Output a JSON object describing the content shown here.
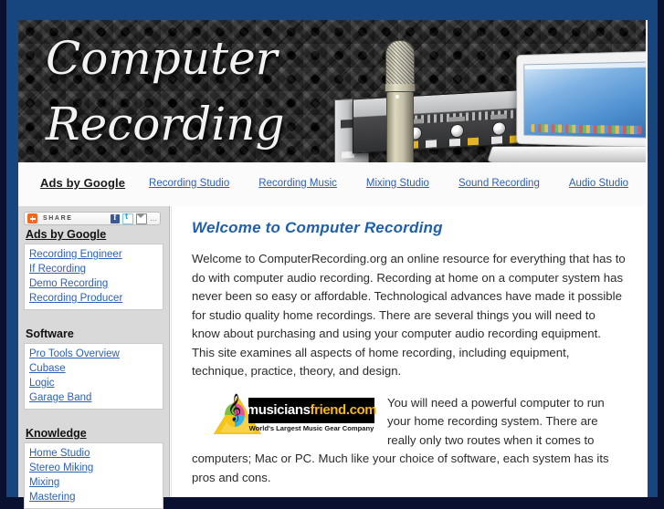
{
  "banner": {
    "title_line1": "Computer",
    "title_line2": "Recording",
    "title": "Computer\nRecording",
    "artwork": [
      "acoustic-foam-background",
      "condenser-microphone",
      "rack-preamp",
      "macbook-laptop"
    ]
  },
  "ad_nav": {
    "lead_label": "Ads by Google",
    "links": [
      "Recording Studio",
      "Recording Music",
      "Mixing Studio",
      "Sound Recording",
      "Audio Studio"
    ]
  },
  "sidebar": {
    "share": {
      "label": "SHARE",
      "plus_icon": "addthis-plus-icon",
      "icons": [
        "facebook-icon",
        "twitter-icon",
        "email-icon",
        "more-icon"
      ],
      "more_label": "…"
    },
    "sections": [
      {
        "heading": "Ads by Google",
        "underlined": true,
        "items": [
          "Recording Engineer",
          "If Recording",
          "Demo Recording",
          "Recording Producer"
        ]
      },
      {
        "heading": "Software",
        "underlined": false,
        "items": [
          "Pro Tools Overview",
          "Cubase",
          "Logic",
          "Garage Band"
        ]
      },
      {
        "heading": "Knowledge",
        "underlined": true,
        "items": [
          "Home Studio",
          "Stereo Miking",
          "Mixing",
          "Mastering"
        ]
      }
    ]
  },
  "main": {
    "heading": "Welcome to Computer Recording",
    "paragraph1": "Welcome to ComputerRecording.org an online resource for everything that has to do with computer audio recording. Recording at home on a computer system has never been so easy or affordable. Technological advances have made it possible for studio quality home recordings. There are several things you will need to know about purchasing and using your computer audio recording equipment. This site examines all aspects of home recording, including equipment, technique, practice, theory, and design.",
    "paragraph2": "You will need a powerful computer to run your home recording system. There are really only two routes when it comes to computers; Mac or PC. Much like your choice of software, each system has its pros and cons.",
    "ad_logo": {
      "name_part1": "musicians",
      "name_part2": "friend.com",
      "tagline": "World's Largest Music Gear Company"
    }
  },
  "colors": {
    "frame_outer": "#0a1030",
    "frame_blue": "#17457e",
    "link_blue": "#2b5fb8",
    "heading_blue": "#1f5fb0",
    "sidebar_bg": "#d9d9d9",
    "share_orange": "#ef6a20",
    "logo_yellow": "#f5c518"
  }
}
